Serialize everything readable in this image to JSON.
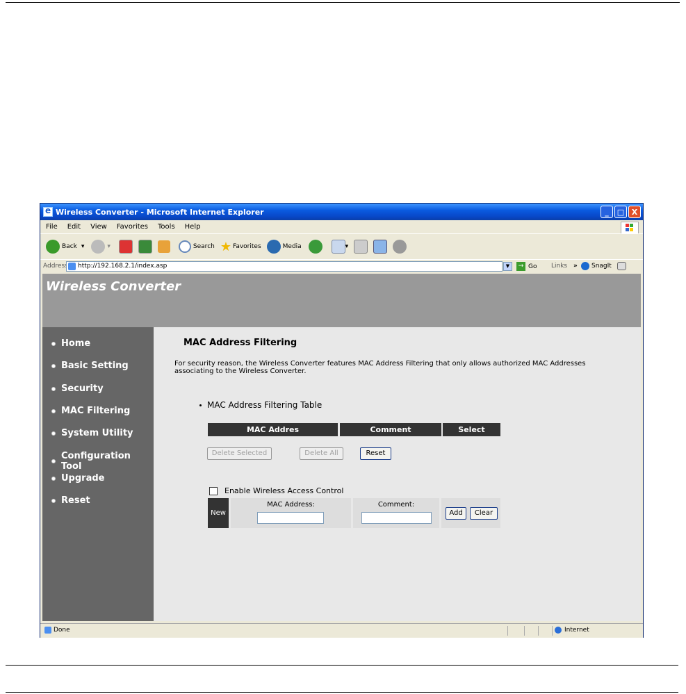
{
  "window": {
    "title": "Wireless Converter - Microsoft Internet Explorer",
    "controls": {
      "minimize": "_",
      "maximize": "□",
      "close": "X"
    }
  },
  "menubar": [
    "File",
    "Edit",
    "View",
    "Favorites",
    "Tools",
    "Help"
  ],
  "toolbar": {
    "back_label": "Back",
    "search_label": "Search",
    "favorites_label": "Favorites",
    "media_label": "Media"
  },
  "addressbar": {
    "label": "Address",
    "url": "http://192.168.2.1/index.asp",
    "go_label": "Go",
    "links_label": "Links",
    "chevron": "»",
    "snagit_label": "SnagIt"
  },
  "page": {
    "banner_title": "Wireless Converter",
    "nav": [
      "Home",
      "Basic Setting",
      "Security",
      "MAC Filtering",
      "System Utility",
      "Configuration Tool",
      "Upgrade",
      "Reset"
    ],
    "heading": "MAC Address Filtering",
    "description": "For security reason, the Wireless Converter features MAC Address Filtering that only allows authorized MAC Addresses associating to the Wireless Converter.",
    "table_title": "MAC Address Filtering Table",
    "table_headers": [
      "MAC Addres",
      "Comment",
      "Select"
    ],
    "buttons": {
      "delete_selected": "Delete Selected",
      "delete_all": "Delete All",
      "reset": "Reset"
    },
    "enable_label": "Enable Wireless Access Control",
    "new_label": "New",
    "mac_field_label": "MAC Address:",
    "comment_field_label": "Comment:",
    "add_label": "Add",
    "clear_label": "Clear",
    "mac_value": "",
    "comment_value": ""
  },
  "status": {
    "text": "Done",
    "zone": "Internet"
  },
  "colors": {
    "banner": "#999999",
    "sidebar": "#666666",
    "header_cells": "#333333",
    "titlebar": "#0a5be0"
  }
}
